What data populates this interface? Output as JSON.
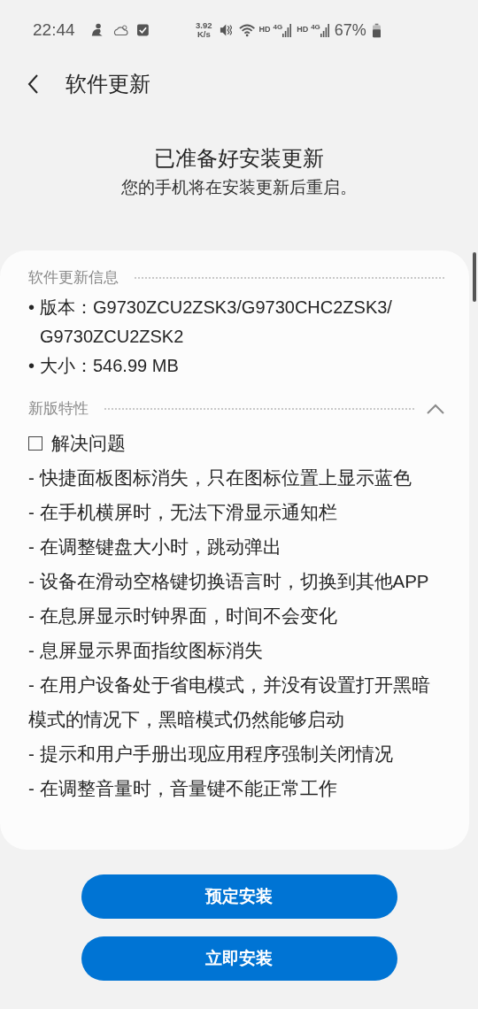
{
  "status_bar": {
    "time": "22:44",
    "speed_value": "3.92",
    "speed_unit": "K/s",
    "sims": [
      {
        "hd": "HD",
        "network": "4G"
      },
      {
        "hd": "HD",
        "network": "4G"
      }
    ],
    "battery": "67%"
  },
  "header": {
    "title": "软件更新"
  },
  "intro": {
    "title": "已准备好安装更新",
    "subtitle": "您的手机将在安装更新后重启。"
  },
  "info": {
    "title": "软件更新信息",
    "items": [
      {
        "bullet": "•",
        "text": "版本：G9730ZCU2ZSK3/G9730CHC2ZSK3/G9730ZCU2ZSK2"
      },
      {
        "bullet": "•",
        "text": "大小：546.99 MB"
      }
    ]
  },
  "features": {
    "title": "新版特性",
    "expanded": true,
    "items": [
      {
        "kind": "checkbox",
        "checked": false,
        "text": "解决问题"
      },
      {
        "kind": "line",
        "text": "- 快捷面板图标消失，只在图标位置上显示蓝色"
      },
      {
        "kind": "line",
        "text": "- 在手机横屏时，无法下滑显示通知栏"
      },
      {
        "kind": "line",
        "text": "- 在调整键盘大小时，跳动弹出"
      },
      {
        "kind": "line",
        "text": "- 设备在滑动空格键切换语言时，切换到其他APP"
      },
      {
        "kind": "line",
        "text": "- 在息屏显示时钟界面，时间不会变化"
      },
      {
        "kind": "line",
        "text": "- 息屏显示界面指纹图标消失"
      },
      {
        "kind": "line",
        "text": "- 在用户设备处于省电模式，并没有设置打开黑暗模式的情况下，黑暗模式仍然能够启动"
      },
      {
        "kind": "line",
        "text": "- 提示和用户手册出现应用程序强制关闭情况"
      },
      {
        "kind": "line",
        "text": "- 在调整音量时，音量键不能正常工作"
      }
    ]
  },
  "buttons": [
    {
      "label": "预定安装"
    },
    {
      "label": "立即安装"
    }
  ]
}
